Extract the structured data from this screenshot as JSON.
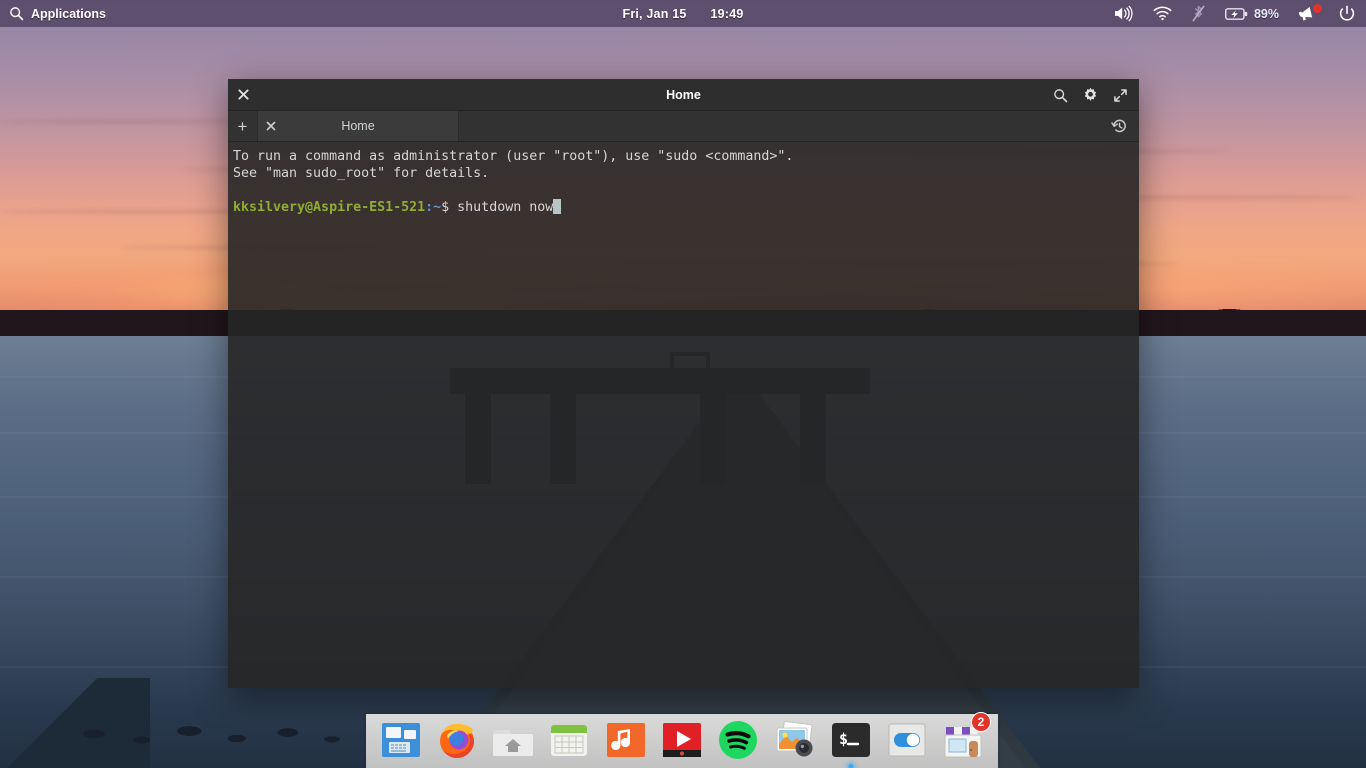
{
  "panel": {
    "applications_label": "Applications",
    "search_icon": "search-icon",
    "clock_date": "Fri, Jan 15",
    "clock_time": "19:49",
    "battery_percent": "89%",
    "tray": [
      {
        "name": "volume-icon",
        "state": "on"
      },
      {
        "name": "wifi-icon",
        "state": "connected"
      },
      {
        "name": "bluetooth-icon",
        "state": "disabled"
      },
      {
        "name": "battery-icon",
        "state": "charging"
      },
      {
        "name": "notifications-icon",
        "state": "has-new"
      },
      {
        "name": "power-icon",
        "state": "idle"
      }
    ],
    "background_color": "#564866"
  },
  "terminal": {
    "window_title": "Home",
    "titlebar_buttons": {
      "close": "close-icon",
      "search": "search-icon",
      "settings": "gear-icon",
      "maximize": "maximize-icon"
    },
    "tabbar": {
      "new_tab_label": "+",
      "history_icon": "history-icon",
      "tabs": [
        {
          "label": "Home",
          "close_label": "✕",
          "active": true
        }
      ]
    },
    "lines": [
      {
        "segments": [
          {
            "text": "To run a command as administrator (user \"root\"), use \"sudo <command>\".",
            "style": "normal"
          }
        ]
      },
      {
        "segments": [
          {
            "text": "See \"man sudo_root\" for details.",
            "style": "normal"
          }
        ]
      },
      {
        "segments": [
          {
            "text": "",
            "style": "normal"
          }
        ]
      },
      {
        "segments": [
          {
            "text": "kksilvery@Aspire-ES1-521",
            "style": "prompt"
          },
          {
            "text": ":~",
            "style": "path"
          },
          {
            "text": "$ shutdown now",
            "style": "normal"
          },
          {
            "text": "",
            "style": "cursor"
          }
        ]
      }
    ],
    "colors": {
      "prompt": "#8fae2e",
      "path": "#6b8ec8",
      "text": "#d6d6d6",
      "background": "#262626",
      "cursor": "#b8c6c6"
    }
  },
  "dock": {
    "items": [
      {
        "name": "window-manager-icon",
        "label": "Window Switcher",
        "running": false,
        "badge": null
      },
      {
        "name": "firefox-icon",
        "label": "Firefox",
        "running": false,
        "badge": null
      },
      {
        "name": "files-icon",
        "label": "Files",
        "running": false,
        "badge": null
      },
      {
        "name": "calendar-icon",
        "label": "Calendar",
        "running": false,
        "badge": null
      },
      {
        "name": "music-icon",
        "label": "Music",
        "running": false,
        "badge": null
      },
      {
        "name": "youtube-icon",
        "label": "YouTube",
        "running": false,
        "badge": null
      },
      {
        "name": "spotify-icon",
        "label": "Spotify",
        "running": false,
        "badge": null
      },
      {
        "name": "photos-icon",
        "label": "Photos",
        "running": false,
        "badge": null
      },
      {
        "name": "terminal-icon",
        "label": "Terminal",
        "running": true,
        "badge": null
      },
      {
        "name": "settings-icon",
        "label": "Settings",
        "running": false,
        "badge": null
      },
      {
        "name": "software-center-icon",
        "label": "Software Updates",
        "running": false,
        "badge": "2"
      }
    ],
    "badge_color": "#e2342a",
    "running_indicator_color": "#3ea8f5"
  },
  "wallpaper": {
    "description": "sunset-lake-pier",
    "sky_top_color": "#8d7f9e",
    "sky_bottom_color": "#f2a87e",
    "water_color": "#5b6d86"
  }
}
